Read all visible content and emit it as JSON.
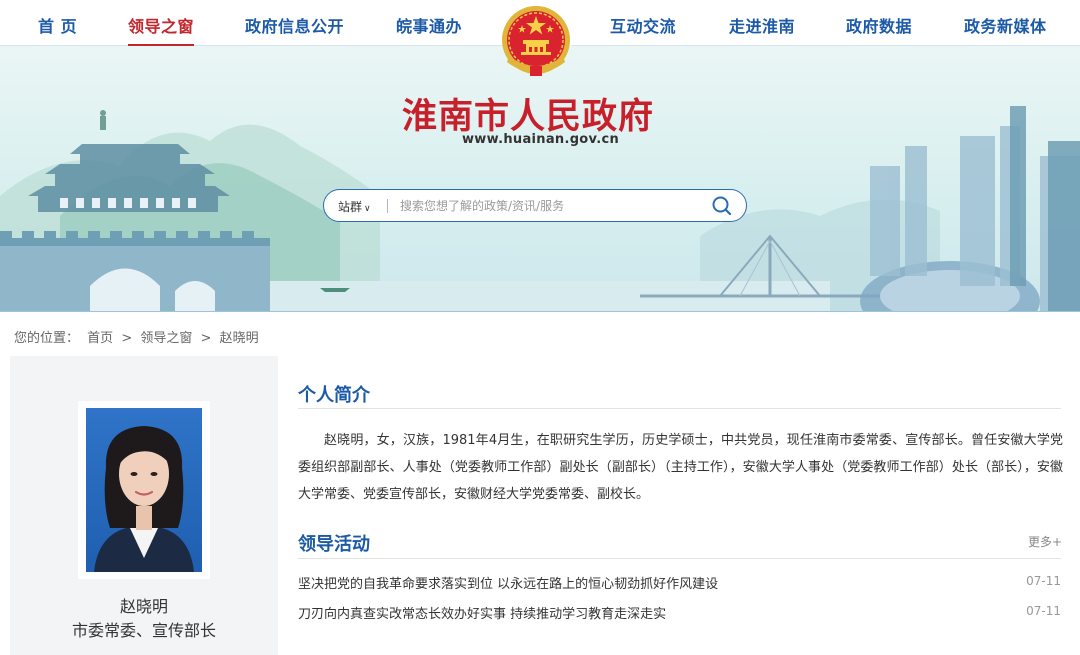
{
  "nav": {
    "items": [
      {
        "label": "首 页"
      },
      {
        "label": "领导之窗"
      },
      {
        "label": "政府信息公开"
      },
      {
        "label": "皖事通办"
      },
      {
        "label": "互动交流"
      },
      {
        "label": "走进淮南"
      },
      {
        "label": "政府数据"
      },
      {
        "label": "政务新媒体"
      }
    ],
    "active_index": 1
  },
  "header": {
    "site_title": "淮南市人民政府",
    "site_url": "www.huainan.gov.cn",
    "emblem_icon": "national-emblem-icon"
  },
  "search": {
    "scope_label": "站群",
    "placeholder": "搜索您想了解的政策/资讯/服务",
    "value": "",
    "button_icon": "search-icon"
  },
  "breadcrumb": {
    "prefix": "您的位置：",
    "items": [
      "首页",
      "领导之窗",
      "赵晓明"
    ],
    "separator": ">"
  },
  "profile": {
    "name": "赵晓明",
    "title": "市委常委、宣传部长"
  },
  "bio_section": {
    "heading": "个人简介",
    "text": "赵晓明，女，汉族，1981年4月生，在职研究生学历，历史学硕士，中共党员，现任淮南市委常委、宣传部长。曾任安徽大学党委组织部副部长、人事处（党委教师工作部）副处长（副部长）（主持工作），安徽大学人事处（党委教师工作部）处长（部长），安徽大学常委、党委宣传部长，安徽财经大学党委常委、副校长。"
  },
  "activity_section": {
    "heading": "领导活动",
    "more_label": "更多+",
    "items": [
      {
        "title": "坚决把党的自我革命要求落实到位 以永远在路上的恒心韧劲抓好作风建设",
        "date": "07-11"
      },
      {
        "title": "刀刃向内真查实改常态长效办好实事 持续推动学习教育走深走实",
        "date": "07-11"
      }
    ]
  },
  "colors": {
    "nav_text": "#1c5aa8",
    "nav_active": "#c0272d",
    "title_red": "#c8202b",
    "heading_blue": "#1c5aa8"
  }
}
